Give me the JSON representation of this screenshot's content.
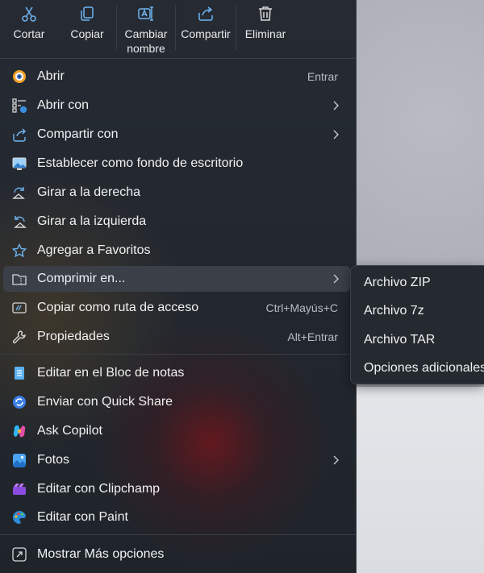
{
  "toolbar": [
    {
      "label": "Cortar",
      "icon": "scissors-icon"
    },
    {
      "label": "Copiar",
      "icon": "copy-icon"
    },
    {
      "label_line1": "Cambiar",
      "label_line2": "nombre",
      "icon": "rename-icon"
    },
    {
      "label": "Compartir",
      "icon": "share-icon"
    },
    {
      "label": "Eliminar",
      "icon": "trash-icon"
    }
  ],
  "menu": {
    "items": [
      {
        "label": "Abrir",
        "shortcut": "Entrar",
        "icon": "image-viewer-icon"
      },
      {
        "label": "Abrir con",
        "icon": "open-with-icon",
        "submenu": true
      },
      {
        "label": "Compartir con",
        "icon": "share-with-icon",
        "submenu": true
      },
      {
        "label": "Establecer como fondo de escritorio",
        "icon": "wallpaper-icon"
      },
      {
        "label": "Girar a la derecha",
        "icon": "rotate-right-icon"
      },
      {
        "label": "Girar a la izquierda",
        "icon": "rotate-left-icon"
      },
      {
        "label": "Agregar a Favoritos",
        "icon": "star-icon"
      },
      {
        "label": "Comprimir en...",
        "icon": "compress-folder-icon",
        "submenu": true,
        "active": true
      },
      {
        "label": "Copiar como ruta de acceso",
        "shortcut": "Ctrl+Mayús+C",
        "icon": "copy-path-icon"
      },
      {
        "label": "Propiedades",
        "shortcut": "Alt+Entrar",
        "icon": "wrench-icon"
      },
      {
        "label": "Editar en el Bloc de notas",
        "icon": "notepad-icon"
      },
      {
        "label": "Enviar con Quick Share",
        "icon": "quick-share-icon"
      },
      {
        "label": "Ask Copilot",
        "icon": "copilot-icon"
      },
      {
        "label": "Fotos",
        "icon": "photos-icon",
        "submenu": true
      },
      {
        "label": "Editar con Clipchamp",
        "icon": "clipchamp-icon"
      },
      {
        "label": "Editar con Paint",
        "icon": "paint-icon"
      },
      {
        "label": "Mostrar Más opciones",
        "icon": "more-options-icon"
      }
    ]
  },
  "submenu": {
    "items": [
      "Archivo ZIP",
      "Archivo 7z",
      "Archivo TAR",
      "Opciones adicionales"
    ]
  },
  "colors": {
    "menu_bg": "#22272e",
    "text": "#f1f1f1",
    "shortcut": "#b9bcc1",
    "active_bg": "#3a3f48",
    "accent_blue": "#4aa3f0"
  }
}
